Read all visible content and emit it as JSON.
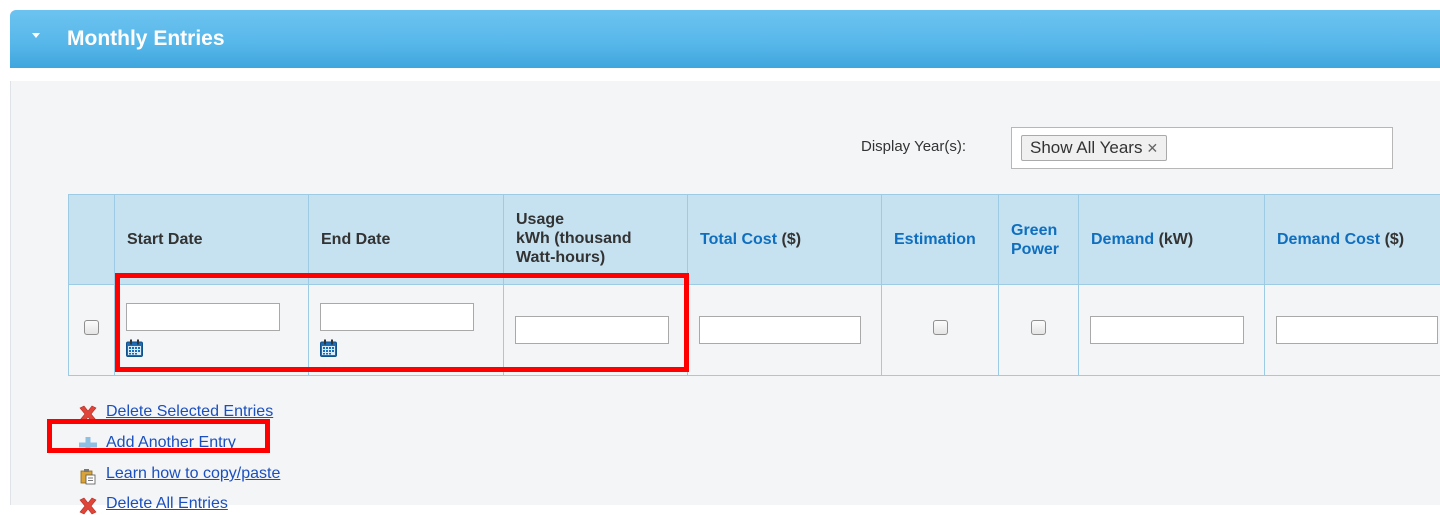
{
  "panel": {
    "title": "Monthly Entries",
    "collapse_icon": "caret-down-icon"
  },
  "year_filter": {
    "label": "Display Year(s):",
    "selected": "Show All Years",
    "remove_symbol": "✕"
  },
  "table": {
    "columns": [
      {
        "key": "select",
        "label": ""
      },
      {
        "key": "start_date",
        "label": "Start Date"
      },
      {
        "key": "end_date",
        "label": "End Date"
      },
      {
        "key": "usage",
        "label": "Usage\nkWh (thousand\nWatt-hours)"
      },
      {
        "key": "total_cost",
        "label": "Total Cost",
        "unit": "($)"
      },
      {
        "key": "estimation",
        "label": "Estimation"
      },
      {
        "key": "green_power",
        "label": "Green\nPower"
      },
      {
        "key": "demand",
        "label": "Demand",
        "unit": "(kW)"
      },
      {
        "key": "demand_cost",
        "label": "Demand Cost",
        "unit": "($)"
      }
    ],
    "rows": [
      {
        "start_date": "",
        "end_date": "",
        "usage": "",
        "total_cost": "",
        "estimation": false,
        "green_power": false,
        "demand": "",
        "demand_cost": ""
      }
    ]
  },
  "actions": [
    {
      "label": "Delete Selected Entries",
      "icon": "red-x-icon"
    },
    {
      "label": "Add Another Entry",
      "icon": "plus-icon"
    },
    {
      "label": "Learn how to copy/paste",
      "icon": "clipboard-icon"
    },
    {
      "label": "Delete All Entries",
      "icon": "red-x-icon"
    }
  ],
  "colors": {
    "header_blue": "#58b8ea",
    "link_blue": "#1a4fbf",
    "table_header_bg": "#c6e2f1",
    "highlight_red": "#ff0000"
  }
}
